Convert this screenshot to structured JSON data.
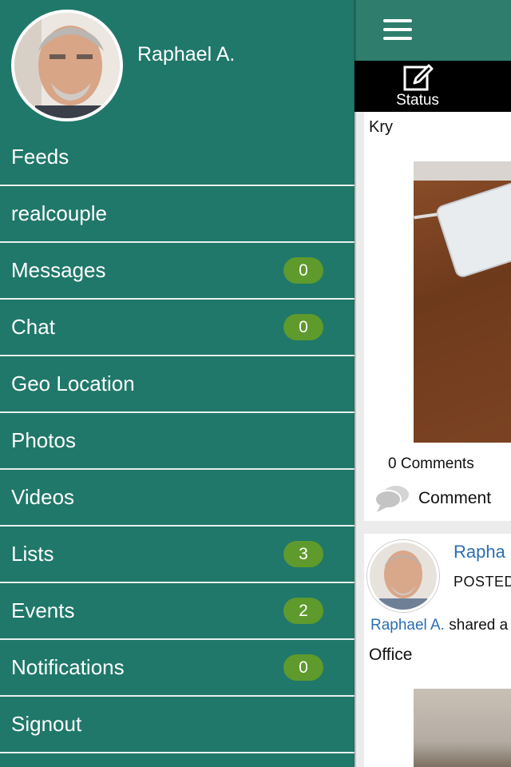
{
  "profile": {
    "name": "Raphael A."
  },
  "menu": [
    {
      "label": "Feeds"
    },
    {
      "label": "realcouple"
    },
    {
      "label": "Messages",
      "badge": "0"
    },
    {
      "label": "Chat",
      "badge": "0"
    },
    {
      "label": "Geo Location"
    },
    {
      "label": "Photos"
    },
    {
      "label": "Videos"
    },
    {
      "label": "Lists",
      "badge": "3"
    },
    {
      "label": "Events",
      "badge": "2"
    },
    {
      "label": "Notifications",
      "badge": "0"
    },
    {
      "label": "Signout"
    }
  ],
  "feed": {
    "status_label": "Status",
    "post1": {
      "author": "Kry",
      "comments_count": "0 Comments",
      "comment_label": "Comment"
    },
    "post2": {
      "author": "Rapha",
      "posted": "POSTED",
      "shared_by": "Raphael A.",
      "shared_text": "shared a",
      "text": "Office"
    }
  },
  "colors": {
    "drawer": "#20786a",
    "topbar": "#2e7d6d",
    "badge": "#5e9a2c",
    "link": "#2a6fb2"
  }
}
